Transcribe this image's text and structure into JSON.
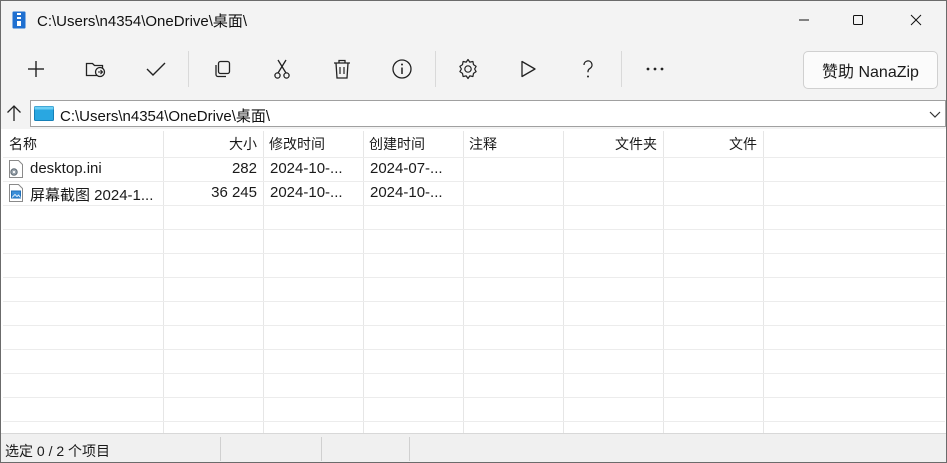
{
  "window": {
    "title": "C:\\Users\\n4354\\OneDrive\\桌面\\"
  },
  "toolbar": {
    "buttons": [
      {
        "name": "add-button",
        "icon": "plus-icon"
      },
      {
        "name": "extract-button",
        "icon": "folder-extract-icon"
      },
      {
        "name": "test-button",
        "icon": "checkmark-icon"
      },
      {
        "name": "copy-button",
        "icon": "copy-icon"
      },
      {
        "name": "move-button",
        "icon": "scissors-icon"
      },
      {
        "name": "delete-button",
        "icon": "trash-icon"
      },
      {
        "name": "info-button",
        "icon": "info-icon"
      },
      {
        "name": "settings-button",
        "icon": "gear-icon"
      },
      {
        "name": "benchmark-button",
        "icon": "play-icon"
      },
      {
        "name": "help-button",
        "icon": "question-icon"
      },
      {
        "name": "more-button",
        "icon": "more-icon"
      }
    ],
    "sponsor_label": "赞助 NanaZip"
  },
  "address": {
    "path": "C:\\Users\\n4354\\OneDrive\\桌面\\"
  },
  "columns": [
    {
      "label": "名称"
    },
    {
      "label": "大小"
    },
    {
      "label": "修改时间"
    },
    {
      "label": "创建时间"
    },
    {
      "label": "注释"
    },
    {
      "label": "文件夹"
    },
    {
      "label": "文件"
    }
  ],
  "files": [
    {
      "name": "desktop.ini",
      "size": "282",
      "modified": "2024-10-...",
      "created": "2024-07-...",
      "icon": "settings-file-icon"
    },
    {
      "name": "屏幕截图 2024-1...",
      "size": "36 245",
      "modified": "2024-10-...",
      "created": "2024-10-...",
      "icon": "image-file-icon"
    }
  ],
  "status": {
    "selection": "选定 0 / 2 个项目"
  },
  "colors": {
    "chrome": "#f3f3f3",
    "accent": "#0b76c8",
    "grid": "#e6e6e6"
  }
}
